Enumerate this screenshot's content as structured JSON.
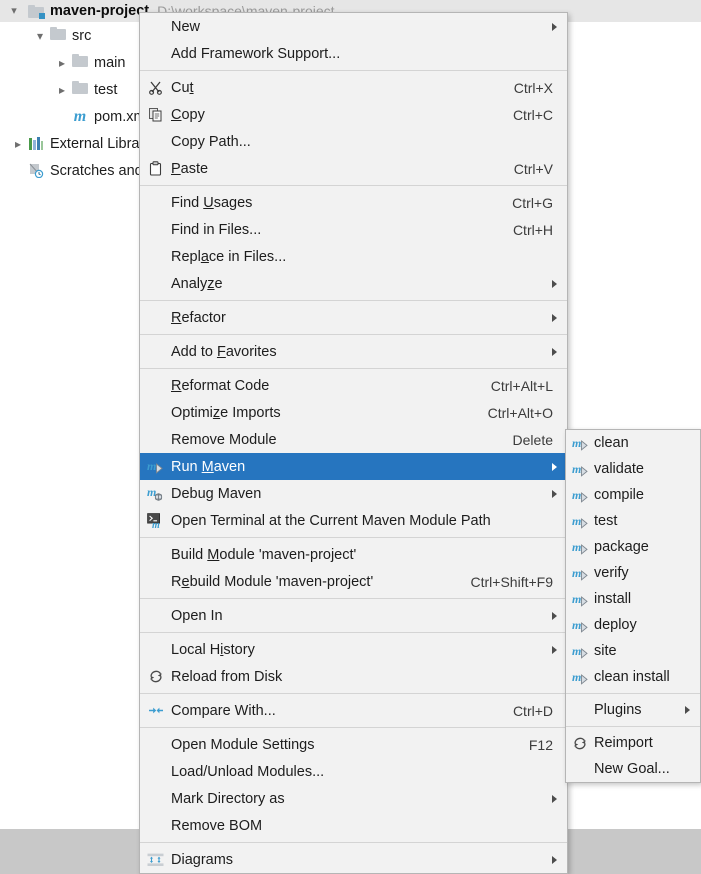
{
  "project": {
    "header": {
      "name": "maven-project",
      "path": "D:\\workspace\\maven-project",
      "expander": "chevron-down"
    },
    "tree": [
      {
        "label": "src",
        "icon": "folder-icon",
        "expander": "chevron-down",
        "indent": 1
      },
      {
        "label": "main",
        "icon": "folder-icon",
        "expander": "chevron-right",
        "indent": 2
      },
      {
        "label": "test",
        "icon": "folder-icon",
        "expander": "chevron-right",
        "indent": 2
      },
      {
        "label": "pom.xml",
        "icon": "maven-file-icon",
        "expander": "",
        "indent": 2
      },
      {
        "label": "External Libraries",
        "icon": "libraries-icon",
        "expander": "chevron-right",
        "indent": 0
      },
      {
        "label": "Scratches and Consoles",
        "icon": "scratches-icon",
        "expander": "",
        "indent": 0
      }
    ]
  },
  "context_menu": {
    "items": [
      {
        "label": "New",
        "accel": "",
        "icon": "",
        "submenu": true
      },
      {
        "label": "Add Framework Support...",
        "accel": "",
        "icon": "",
        "submenu": false
      },
      {
        "separator": true
      },
      {
        "label": "Cut",
        "mnemonic": "t",
        "accel": "Ctrl+X",
        "icon": "cut-icon",
        "submenu": false
      },
      {
        "label": "Copy",
        "mnemonic": "C",
        "accel": "Ctrl+C",
        "icon": "copy-icon",
        "submenu": false
      },
      {
        "label": "Copy Path...",
        "accel": "",
        "icon": "",
        "submenu": false
      },
      {
        "label": "Paste",
        "mnemonic": "P",
        "accel": "Ctrl+V",
        "icon": "paste-icon",
        "submenu": false
      },
      {
        "separator": true
      },
      {
        "label": "Find Usages",
        "mnemonic": "U",
        "accel": "Ctrl+G",
        "icon": "",
        "submenu": false
      },
      {
        "label": "Find in Files...",
        "accel": "Ctrl+H",
        "icon": "",
        "submenu": false
      },
      {
        "label": "Replace in Files...",
        "mnemonic": "a",
        "accel": "",
        "icon": "",
        "submenu": false
      },
      {
        "label": "Analyze",
        "mnemonic": "z",
        "accel": "",
        "icon": "",
        "submenu": true
      },
      {
        "separator": true
      },
      {
        "label": "Refactor",
        "mnemonic": "R",
        "accel": "",
        "icon": "",
        "submenu": true
      },
      {
        "separator": true
      },
      {
        "label": "Add to Favorites",
        "mnemonic": "F",
        "accel": "",
        "icon": "",
        "submenu": true
      },
      {
        "separator": true
      },
      {
        "label": "Reformat Code",
        "mnemonic": "R",
        "accel": "Ctrl+Alt+L",
        "icon": "",
        "submenu": false
      },
      {
        "label": "Optimize Imports",
        "mnemonic": "z",
        "accel": "Ctrl+Alt+O",
        "icon": "",
        "submenu": false
      },
      {
        "label": "Remove Module",
        "accel": "Delete",
        "icon": "",
        "submenu": false
      },
      {
        "label": "Run Maven",
        "mnemonic": "M",
        "accel": "",
        "icon": "maven-run-icon",
        "submenu": true,
        "selected": true
      },
      {
        "label": "Debug Maven",
        "accel": "",
        "icon": "maven-debug-icon",
        "submenu": true
      },
      {
        "label": "Open Terminal at the Current Maven Module Path",
        "accel": "",
        "icon": "terminal-maven-icon",
        "submenu": false
      },
      {
        "separator": true
      },
      {
        "label": "Build Module 'maven-project'",
        "mnemonic": "M",
        "accel": "",
        "icon": "",
        "submenu": false
      },
      {
        "label": "Rebuild Module 'maven-project'",
        "mnemonic": "e",
        "accel": "Ctrl+Shift+F9",
        "icon": "",
        "submenu": false
      },
      {
        "separator": true
      },
      {
        "label": "Open In",
        "accel": "",
        "icon": "",
        "submenu": true
      },
      {
        "separator": true
      },
      {
        "label": "Local History",
        "mnemonic": "i",
        "accel": "",
        "icon": "",
        "submenu": true
      },
      {
        "label": "Reload from Disk",
        "accel": "",
        "icon": "reload-icon",
        "submenu": false
      },
      {
        "separator": true
      },
      {
        "label": "Compare With...",
        "accel": "Ctrl+D",
        "icon": "compare-icon",
        "submenu": false
      },
      {
        "separator": true
      },
      {
        "label": "Open Module Settings",
        "accel": "F12",
        "icon": "",
        "submenu": false
      },
      {
        "label": "Load/Unload Modules...",
        "accel": "",
        "icon": "",
        "submenu": false
      },
      {
        "label": "Mark Directory as",
        "accel": "",
        "icon": "",
        "submenu": true
      },
      {
        "label": "Remove BOM",
        "accel": "",
        "icon": "",
        "submenu": false
      },
      {
        "separator": true
      },
      {
        "label": "Diagrams",
        "accel": "",
        "icon": "diagrams-icon",
        "submenu": true
      }
    ]
  },
  "submenu": {
    "items": [
      {
        "label": "clean",
        "icon": "maven-run-icon",
        "submenu": false
      },
      {
        "label": "validate",
        "icon": "maven-run-icon",
        "submenu": false
      },
      {
        "label": "compile",
        "icon": "maven-run-icon",
        "submenu": false
      },
      {
        "label": "test",
        "icon": "maven-run-icon",
        "submenu": false
      },
      {
        "label": "package",
        "icon": "maven-run-icon",
        "submenu": false
      },
      {
        "label": "verify",
        "icon": "maven-run-icon",
        "submenu": false
      },
      {
        "label": "install",
        "icon": "maven-run-icon",
        "submenu": false
      },
      {
        "label": "deploy",
        "icon": "maven-run-icon",
        "submenu": false
      },
      {
        "label": "site",
        "icon": "maven-run-icon",
        "submenu": false
      },
      {
        "label": "clean install",
        "icon": "maven-run-icon",
        "submenu": false
      },
      {
        "separator": true
      },
      {
        "label": "Plugins",
        "icon": "",
        "submenu": true
      },
      {
        "separator": true
      },
      {
        "label": "Reimport",
        "icon": "reload-icon",
        "submenu": false
      },
      {
        "label": "New Goal...",
        "icon": "",
        "submenu": false
      }
    ]
  },
  "colors": {
    "selection": "#2675bf",
    "menu_bg": "#f2f2f2",
    "header_bg": "#e6e6e6",
    "maven_blue": "#3c9dd0",
    "path_text": "#9a9a9a"
  }
}
